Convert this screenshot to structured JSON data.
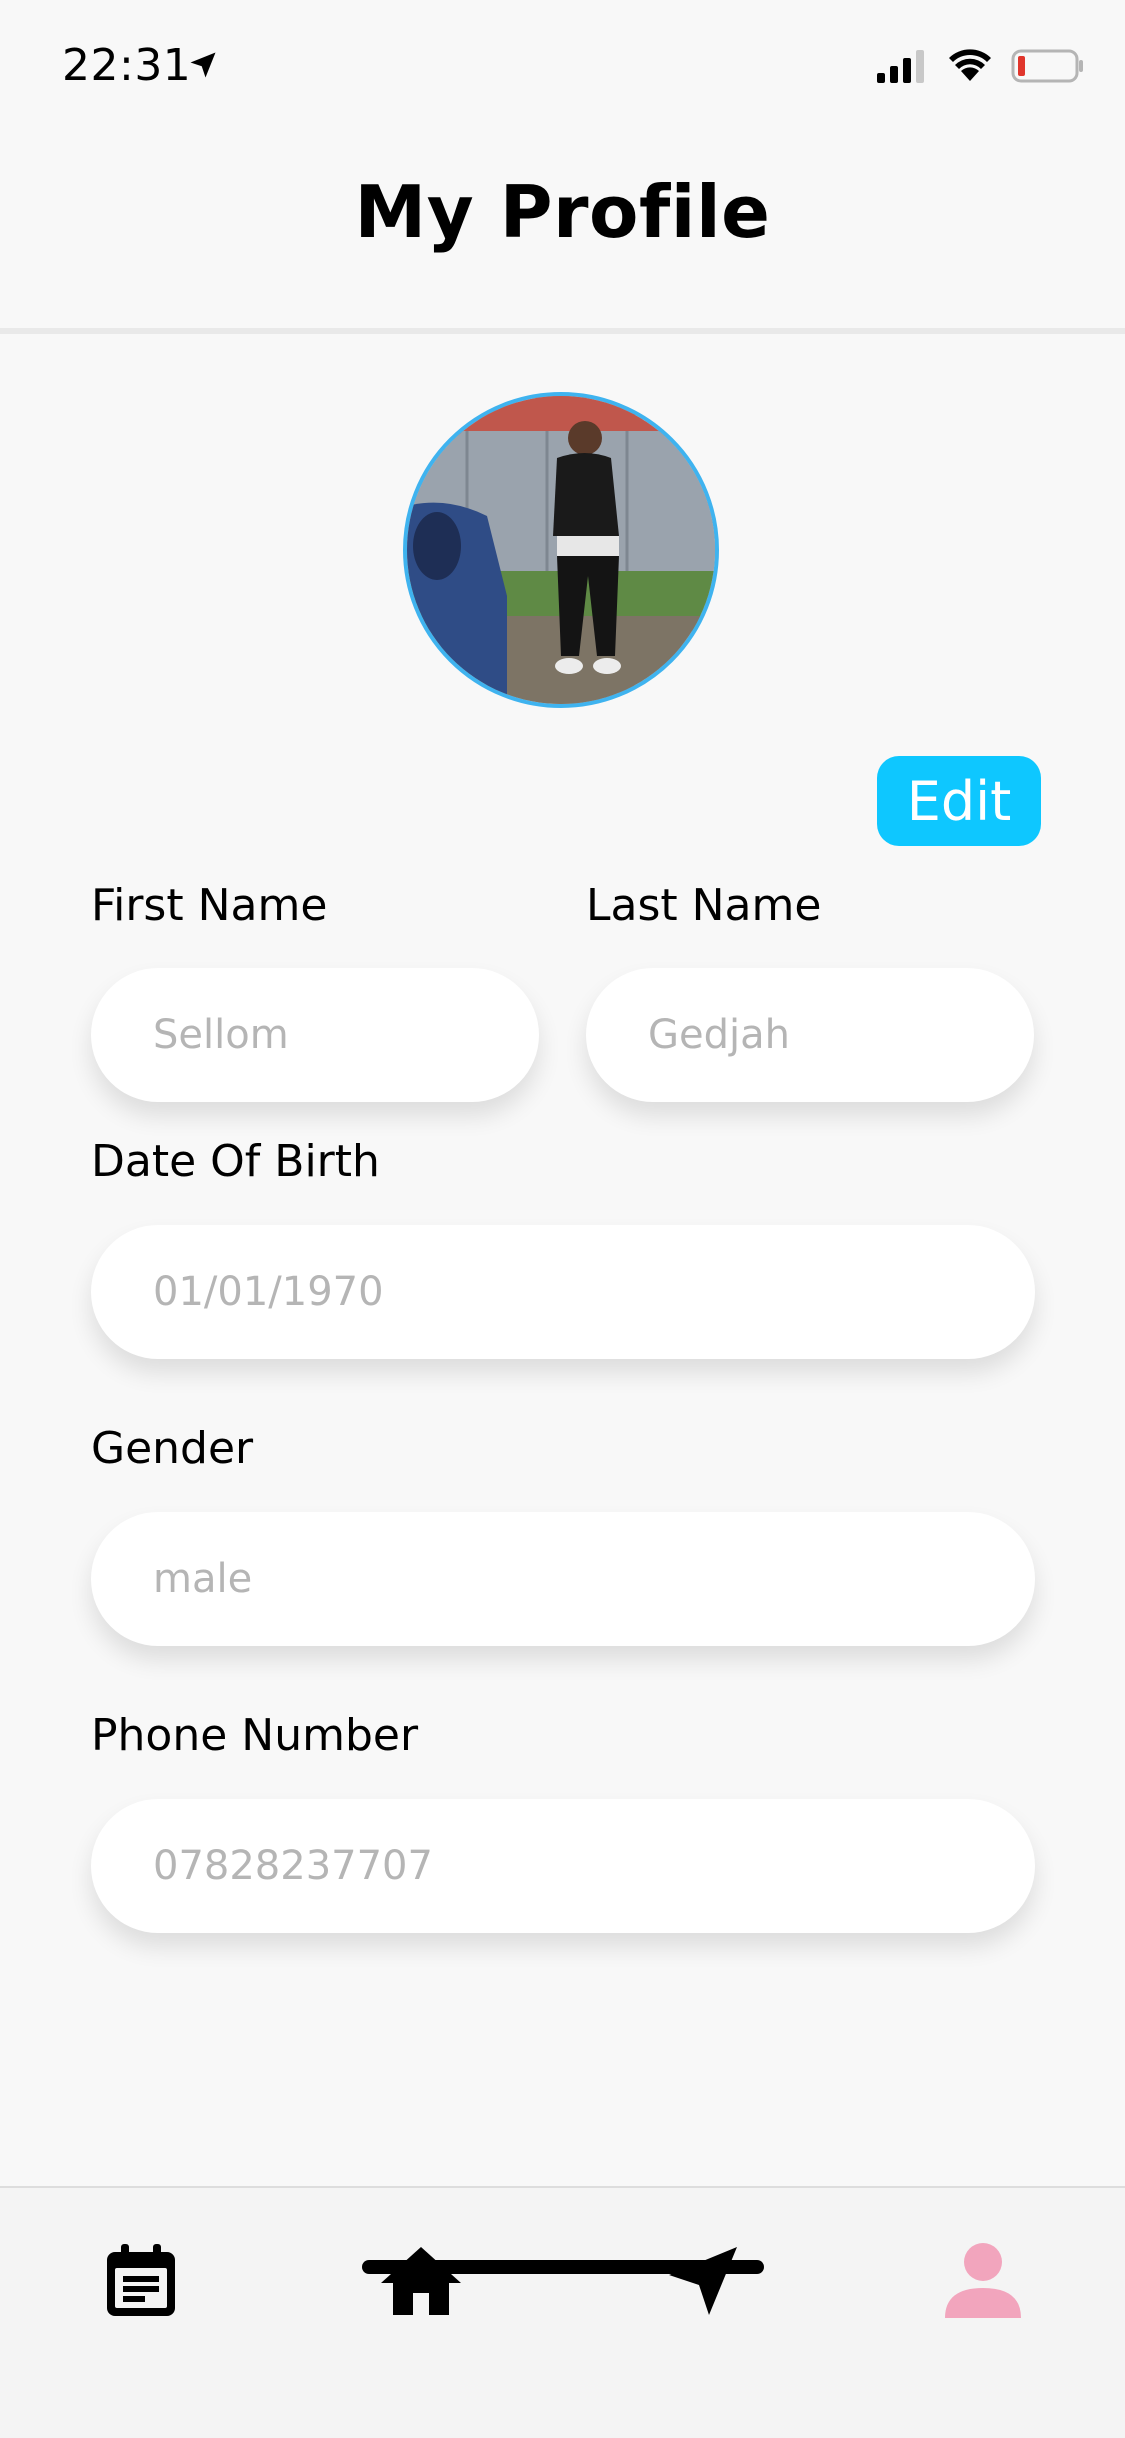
{
  "status_bar": {
    "time": "22:31",
    "icons": [
      "location-arrow-icon",
      "signal-icon",
      "wifi-icon",
      "battery-icon"
    ]
  },
  "header": {
    "title": "My Profile"
  },
  "profile": {
    "avatar_alt": "profile-photo",
    "edit_label": "Edit",
    "accent_color": "#0ec7ff",
    "avatar_ring_color": "#3fb3ef"
  },
  "form": {
    "first_name": {
      "label": "First Name",
      "placeholder": "Sellom"
    },
    "last_name": {
      "label": "Last Name",
      "placeholder": "Gedjah"
    },
    "dob": {
      "label": "Date Of Birth",
      "placeholder": "01/01/1970"
    },
    "gender": {
      "label": "Gender",
      "placeholder": "male"
    },
    "phone": {
      "label": "Phone Number",
      "placeholder": "07828237707"
    }
  },
  "tab_bar": {
    "items": [
      {
        "icon": "calendar-icon",
        "active": false
      },
      {
        "icon": "home-icon",
        "active": false
      },
      {
        "icon": "navigation-icon",
        "active": false
      },
      {
        "icon": "person-icon",
        "active": true
      }
    ],
    "active_color": "#f2a5bd"
  }
}
